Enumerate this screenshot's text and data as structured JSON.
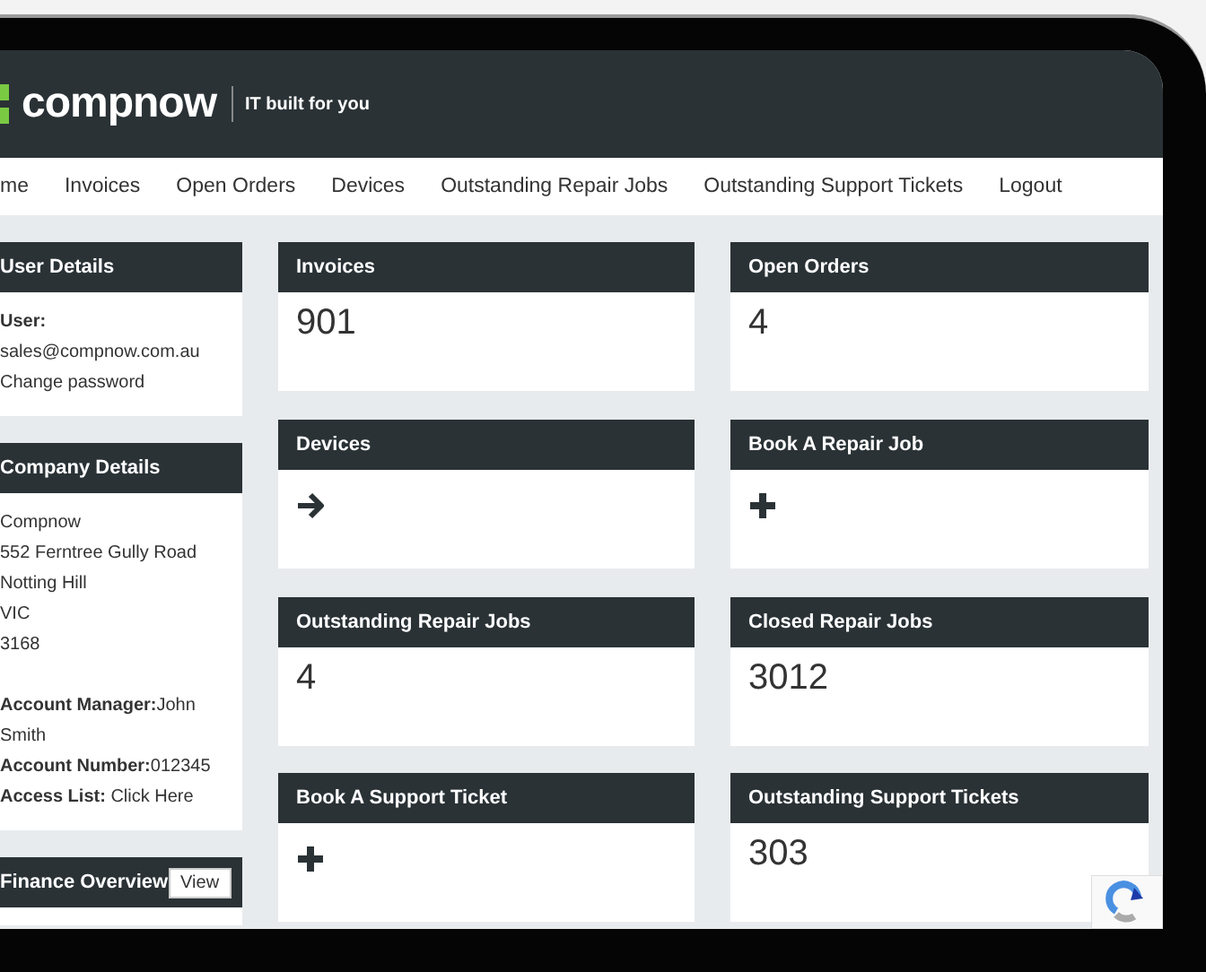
{
  "header": {
    "logo": "compnow",
    "tagline": "IT built for you"
  },
  "nav": [
    "me",
    "Invoices",
    "Open Orders",
    "Devices",
    "Outstanding Repair Jobs",
    "Outstanding Support Tickets",
    "Logout"
  ],
  "sidebar": [
    {
      "title": "User Details",
      "groups": [
        [
          "**User:**",
          "sales@compnow.com.au",
          "Change password"
        ]
      ]
    },
    {
      "title": "Company Details",
      "groups": [
        [
          "Compnow",
          "552 Ferntree Gully Road",
          "Notting Hill",
          "VIC",
          "3168"
        ],
        [
          "**Account Manager:**John",
          "Smith",
          "**Account Number:**012345",
          "**Access List:** Click Here"
        ]
      ]
    },
    {
      "title": "Finance Overview",
      "button": "View"
    }
  ],
  "cards": [
    {
      "title": "Invoices",
      "kind": "count",
      "value": "901"
    },
    {
      "title": "Open Orders",
      "kind": "count",
      "value": "4"
    },
    {
      "title": "Devices",
      "kind": "arrow"
    },
    {
      "title": "Book A Repair Job",
      "kind": "plus"
    },
    {
      "title": "Outstanding Repair Jobs",
      "kind": "count",
      "value": "4"
    },
    {
      "title": "Closed Repair Jobs",
      "kind": "count",
      "value": "3012"
    },
    {
      "title": "Book A Support Ticket",
      "kind": "plus"
    },
    {
      "title": "Outstanding Support Tickets",
      "kind": "count",
      "value": "303"
    }
  ]
}
